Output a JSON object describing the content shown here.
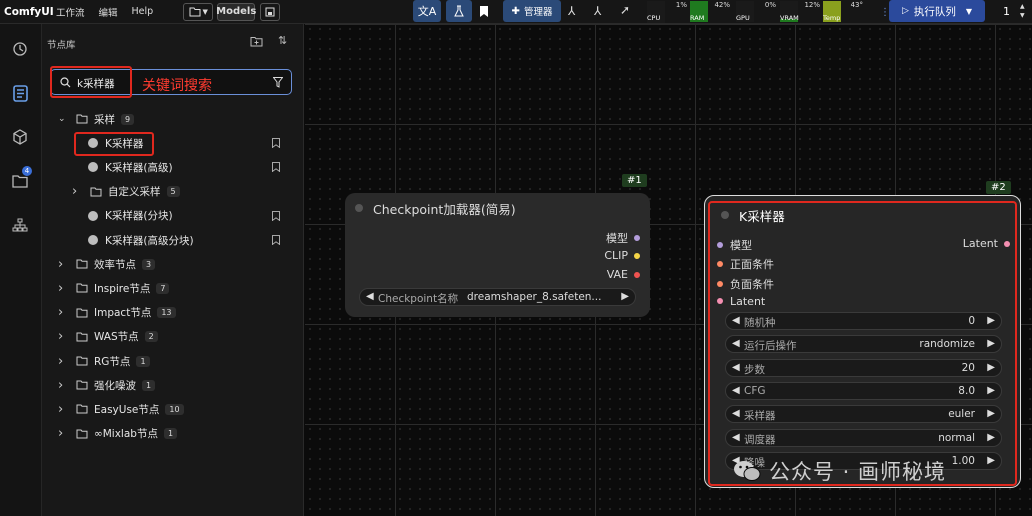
{
  "topbar": {
    "brand": "ComfyUI",
    "menu": [
      "工作流",
      "编辑",
      "Help"
    ],
    "models_label": "Models",
    "manager_label": "管理器",
    "monitors": [
      {
        "label": "CPU",
        "value": "1%",
        "level": 0.01,
        "color": "#1a1a1a"
      },
      {
        "label": "RAM",
        "value": "42%",
        "level": 0.42,
        "color": "#1f7a1f"
      },
      {
        "label": "GPU",
        "value": "0%",
        "level": 0.0,
        "color": "#1a1a1a"
      },
      {
        "label": "VRAM",
        "value": "12%",
        "level": 0.12,
        "color": "#1f7a1f"
      },
      {
        "label": "Temp",
        "value": "43°",
        "level": 0.43,
        "color": "#8aa01e"
      }
    ],
    "queue_label": "执行队列",
    "batch_count": "1"
  },
  "sidebar": {
    "title": "节点库",
    "search_value": "k采样器",
    "annotation": "关键词搜索",
    "rail_badge": "4",
    "tree": [
      {
        "label": "采样",
        "count": "9",
        "kind": "folder-open"
      },
      {
        "label": "K采样器",
        "kind": "leaf"
      },
      {
        "label": "K采样器(高级)",
        "kind": "leaf"
      },
      {
        "label": "自定义采样",
        "count": "5",
        "kind": "folder"
      },
      {
        "label": "K采样器(分块)",
        "kind": "leaf"
      },
      {
        "label": "K采样器(高级分块)",
        "kind": "leaf"
      },
      {
        "label": "效率节点",
        "count": "3",
        "kind": "folder"
      },
      {
        "label": "Inspire节点",
        "count": "7",
        "kind": "folder"
      },
      {
        "label": "Impact节点",
        "count": "13",
        "kind": "folder"
      },
      {
        "label": "WAS节点",
        "count": "2",
        "kind": "folder"
      },
      {
        "label": "RG节点",
        "count": "1",
        "kind": "folder"
      },
      {
        "label": "强化噪波",
        "count": "1",
        "kind": "folder"
      },
      {
        "label": "EasyUse节点",
        "count": "10",
        "kind": "folder"
      },
      {
        "label": "∞Mixlab节点",
        "count": "1",
        "kind": "folder"
      }
    ]
  },
  "nodes": {
    "checkpoint": {
      "id": "#1",
      "title": "Checkpoint加载器(简易)",
      "outputs": [
        {
          "label": "模型",
          "color": "#b39ddb"
        },
        {
          "label": "CLIP",
          "color": "#f5d547"
        },
        {
          "label": "VAE",
          "color": "#ef5350"
        }
      ],
      "widget_label": "Checkpoint名称",
      "widget_value": "dreamshaper_8.safeten..."
    },
    "ksampler": {
      "id": "#2",
      "title": "K采样器",
      "inputs": [
        {
          "label": "模型",
          "color": "#b39ddb"
        },
        {
          "label": "正面条件",
          "color": "#ff8a65"
        },
        {
          "label": "负面条件",
          "color": "#ff8a65"
        },
        {
          "label": "Latent",
          "color": "#f48fb1"
        }
      ],
      "output": {
        "label": "Latent",
        "color": "#f48fb1"
      },
      "widgets": [
        {
          "label": "随机种",
          "value": "0"
        },
        {
          "label": "运行后操作",
          "value": "randomize"
        },
        {
          "label": "步数",
          "value": "20"
        },
        {
          "label": "CFG",
          "value": "8.0"
        },
        {
          "label": "采样器",
          "value": "euler"
        },
        {
          "label": "调度器",
          "value": "normal"
        },
        {
          "label": "降噪",
          "value": "1.00"
        }
      ]
    }
  },
  "watermark": "公众号 · 画师秘境"
}
